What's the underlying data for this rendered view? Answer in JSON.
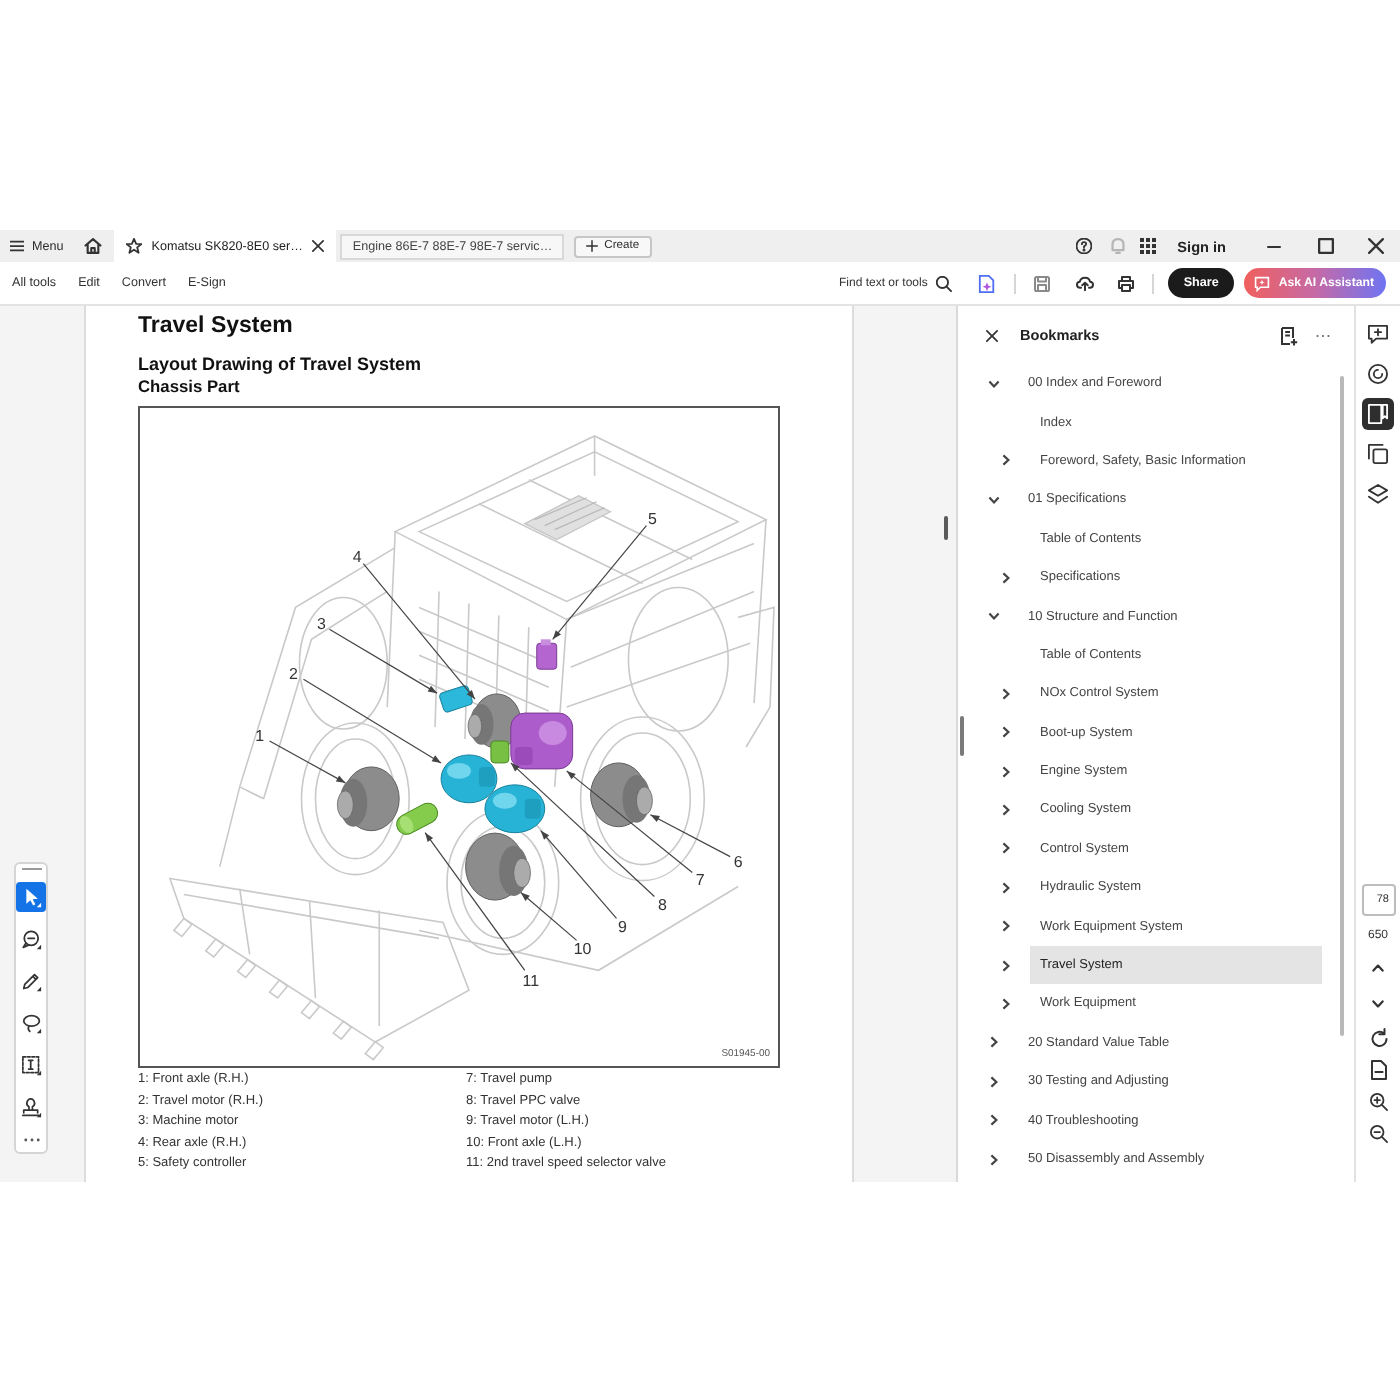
{
  "tab_bar": {
    "menu_label": "Menu",
    "tabs": [
      {
        "title": "Komatsu SK820-8E0 ser…",
        "selected": true
      },
      {
        "title": "Engine 86E-7 88E-7 98E-7 servic…",
        "selected": false
      }
    ],
    "create_label": "Create",
    "sign_in": "Sign in"
  },
  "toolbar": {
    "menu_items": [
      "All tools",
      "Edit",
      "Convert",
      "E-Sign"
    ],
    "search_label": "Find text or tools",
    "share_label": "Share",
    "ai_label": "Ask AI Assistant"
  },
  "document": {
    "title": "Travel System",
    "subtitle": "Layout Drawing of Travel System",
    "section": "Chassis Part",
    "figure": {
      "callouts": [
        "1",
        "2",
        "3",
        "4",
        "5",
        "6",
        "7",
        "8",
        "9",
        "10",
        "11"
      ],
      "drawing_code": "S01945-00"
    },
    "legend": [
      [
        "1: Front axle (R.H.)",
        "2: Travel motor (R.H.)",
        "3: Machine motor",
        "4: Rear axle (R.H.)",
        "5: Safety controller"
      ],
      [
        "7: Travel pump",
        "8: Travel PPC valve",
        "9: Travel motor (L.H.)",
        "10: Front axle (L.H.)",
        "11: 2nd travel speed selector valve"
      ]
    ]
  },
  "tool_palette": [
    {
      "selected": true
    },
    {
      "selected": false
    },
    {
      "selected": false
    },
    {
      "selected": false
    },
    {
      "selected": false
    },
    {
      "selected": false
    }
  ],
  "bookmarks": {
    "title": "Bookmarks",
    "items": [
      {
        "label": "00 Index and Foreword",
        "expanded": true,
        "selected": false,
        "children": [
          {
            "label": "Index",
            "selected": false
          },
          {
            "label": "Foreword, Safety, Basic Information",
            "expanded": false,
            "selected": false
          }
        ]
      },
      {
        "label": "01 Specifications",
        "expanded": true,
        "selected": false,
        "children": [
          {
            "label": "Table of Contents",
            "selected": false
          },
          {
            "label": "Specifications",
            "expanded": false,
            "selected": false
          }
        ]
      },
      {
        "label": "10 Structure and Function",
        "expanded": true,
        "selected": false,
        "children": [
          {
            "label": "Table of Contents",
            "selected": false
          },
          {
            "label": "NOx Control System",
            "expanded": false,
            "selected": false
          },
          {
            "label": "Boot-up System",
            "expanded": false,
            "selected": false
          },
          {
            "label": "Engine System",
            "expanded": false,
            "selected": false
          },
          {
            "label": "Cooling System",
            "expanded": false,
            "selected": false
          },
          {
            "label": "Control System",
            "expanded": false,
            "selected": false
          },
          {
            "label": "Hydraulic System",
            "expanded": false,
            "selected": false
          },
          {
            "label": "Work Equipment System",
            "expanded": false,
            "selected": false
          },
          {
            "label": "Travel System",
            "expanded": false,
            "selected": true
          },
          {
            "label": "Work Equipment",
            "expanded": false,
            "selected": false
          }
        ]
      },
      {
        "label": "20 Standard Value Table",
        "expanded": false,
        "selected": false
      },
      {
        "label": "30 Testing and Adjusting",
        "expanded": false,
        "selected": false
      },
      {
        "label": "40 Troubleshooting",
        "expanded": false,
        "selected": false
      },
      {
        "label": "50 Disassembly and Assembly",
        "expanded": false,
        "selected": false
      }
    ]
  },
  "side_rail": {
    "panels": [
      {
        "selected": false
      },
      {
        "selected": false
      },
      {
        "selected": true
      },
      {
        "selected": false
      },
      {
        "selected": false
      }
    ],
    "page_number": "78",
    "page_count": "650"
  }
}
